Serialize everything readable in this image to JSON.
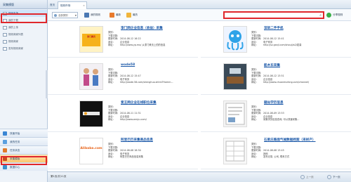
{
  "left_panel": {
    "header": "采集模版",
    "tree": [
      {
        "label": "规则市场",
        "selected": true
      },
      {
        "label": "我的下载",
        "selected": false
      },
      {
        "label": "我的上传",
        "selected": false
      },
      {
        "label": "规则商家列表",
        "selected": false
      },
      {
        "label": "规则商家",
        "selected": false
      },
      {
        "label": "发布规则商家",
        "selected": false
      }
    ],
    "bottom_tabs": [
      {
        "label": "快速开始",
        "icon": "lightning-icon",
        "color": "#3a86d4",
        "active": false
      },
      {
        "label": "我的任务",
        "icon": "task-icon",
        "color": "#5aa0e0",
        "active": false
      },
      {
        "label": "任务状态",
        "icon": "status-icon",
        "color": "#e07a2a",
        "active": false
      },
      {
        "label": "采集模版",
        "icon": "template-icon",
        "color": "#c94a1c",
        "active": true
      },
      {
        "label": "数据中心",
        "icon": "database-icon",
        "color": "#3c8fcc",
        "active": false
      }
    ]
  },
  "tabs": {
    "home": "首页",
    "current": "规则市场"
  },
  "toolbar": {
    "category": "全部类别",
    "btn1": "我的规则",
    "btn2": "最新",
    "btn3": "最热",
    "search_placeholder": "",
    "share": "分享规则"
  },
  "cards": [
    {
      "title": "漆门网企业信息（收益）采集",
      "labels": [
        "类别:",
        "下载次数:",
        "更新时间:",
        "适合:",
        "网址:"
      ],
      "values": [
        "",
        "",
        "2014-08-12 16:22",
        "企业信息",
        "http://www.yp.mo/ 从漆门黄页上的的信息"
      ]
    },
    {
      "title": "深圳二手手机",
      "labels": [
        "类别:",
        "下载次数:",
        "更新时间:",
        "适合:",
        "网址:"
      ],
      "values": [
        "",
        "",
        "2014-08-12 15:41",
        "电子商务",
        "http://sz.ganji.com/shouji/a2/若量"
      ]
    },
    {
      "title": "wode58",
      "labels": [
        "类别:",
        "下载次数:",
        "更新时间:",
        "适合:",
        "网址:"
      ],
      "values": [
        "",
        "",
        "2014-08-12 15:47",
        "电子商务",
        "http://wode.58.com/shenghuo.shtml?fromm..."
      ]
    },
    {
      "title": "船木东采集",
      "labels": [
        "类别:",
        "下载次数:",
        "更新时间:",
        "适合:",
        "网址:"
      ],
      "values": [
        "",
        "",
        "2014-08-12 13:51",
        "企业信息",
        "http://www.chuanmufang.com/channel/"
      ]
    },
    {
      "title": "爱王网企业在线职位采集",
      "labels": [
        "类别:",
        "下载次数:",
        "更新时间:",
        "适合:",
        "网址:"
      ],
      "values": [
        "",
        "",
        "2014-08-11 11:31",
        "企业信息",
        "http://www.woiyu.com/"
      ]
    },
    {
      "title": "疑似学历信息",
      "labels": [
        "类别:",
        "下载次数:",
        "更新时间:",
        "适合:",
        "网址:"
      ],
      "values": [
        "",
        "",
        "2014-08-09 13:53",
        "企业信息",
        "采集学历信息查询, 可以快速采集..."
      ]
    },
    {
      "title": "阿里巴巴采集商品信息",
      "labels": [
        "类别:",
        "下载次数:",
        "更新时间:",
        "适合:",
        "网址:"
      ],
      "values": [
        "",
        "",
        "2014-08-08 18:30",
        "电子商务",
        "阿里巴巴商品信息采集"
      ]
    },
    {
      "title": "石家庄路面气候数据档案（采样产）",
      "labels": [
        "类别:",
        "下载次数:",
        "更新时间:",
        "适合:",
        "网址:"
      ],
      "values": [
        "",
        "",
        "2014-08-08 13:45",
        "其他",
        "发布记录, 公司, 联系方式"
      ]
    }
  ],
  "status": {
    "page_info": "第1页/共11页",
    "prev": "上一页",
    "next": "下一页"
  }
}
